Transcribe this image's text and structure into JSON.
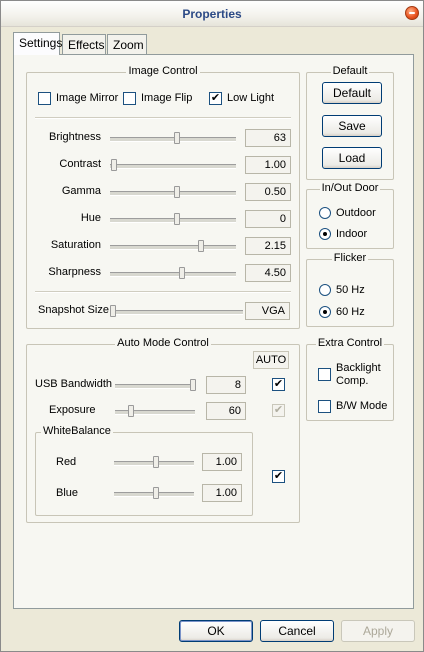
{
  "window": {
    "title": "Properties"
  },
  "tabs": [
    "Settings",
    "Effects",
    "Zoom"
  ],
  "image_control": {
    "title": "Image Control",
    "mirror_label": "Image Mirror",
    "mirror_checked": false,
    "flip_label": "Image Flip",
    "flip_checked": false,
    "lowlight_label": "Low Light",
    "lowlight_checked": true,
    "sliders": [
      {
        "label": "Brightness",
        "value": "63",
        "level": 0.53
      },
      {
        "label": "Contrast",
        "value": "1.00",
        "level": 0.03
      },
      {
        "label": "Gamma",
        "value": "0.50",
        "level": 0.53
      },
      {
        "label": "Hue",
        "value": "0",
        "level": 0.53
      },
      {
        "label": "Saturation",
        "value": "2.15",
        "level": 0.72
      },
      {
        "label": "Sharpness",
        "value": "4.50",
        "level": 0.57
      }
    ],
    "snapshot_label": "Snapshot Size",
    "snapshot_value": "VGA",
    "snapshot_level": 0.02
  },
  "default_group": {
    "title": "Default",
    "default_button": "Default",
    "save_button": "Save",
    "load_button": "Load"
  },
  "inout_group": {
    "title": "In/Out Door",
    "outdoor_label": "Outdoor",
    "indoor_label": "Indoor",
    "selected": "Indoor"
  },
  "flicker_group": {
    "title": "Flicker",
    "hz50_label": "50 Hz",
    "hz60_label": "60 Hz",
    "selected": "60 Hz"
  },
  "auto_mode": {
    "title": "Auto Mode Control",
    "auto_label": "AUTO",
    "usb_label": "USB Bandwidth",
    "usb_value": "8",
    "usb_level": 0.97,
    "usb_auto": true,
    "exposure_label": "Exposure",
    "exposure_value": "60",
    "exposure_level": 0.2,
    "exposure_auto": true,
    "whitebalance_title": "WhiteBalance",
    "red_label": "Red",
    "red_value": "1.00",
    "red_level": 0.52,
    "blue_label": "Blue",
    "blue_value": "1.00",
    "blue_level": 0.52,
    "wb_auto": true
  },
  "extra_control": {
    "title": "Extra Control",
    "backlight_label_1": "Backlight",
    "backlight_label_2": "Comp.",
    "backlight_checked": false,
    "bw_label": "B/W Mode",
    "bw_checked": false
  },
  "footer": {
    "ok": "OK",
    "cancel": "Cancel",
    "apply": "Apply"
  },
  "check_glyph": "✔"
}
